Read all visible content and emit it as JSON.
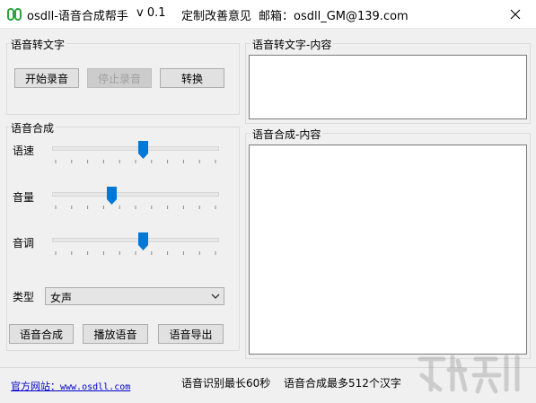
{
  "window": {
    "title": "osdll-语音合成帮手",
    "version": "v 0.1",
    "feedback_link": "定制改善意见",
    "email": "邮箱：osdll_GM@139.com"
  },
  "stt_group": {
    "title": "语音转文字",
    "start_button": "开始录音",
    "stop_button": "停止录音",
    "convert_button": "转换"
  },
  "stt_content": {
    "title": "语音转文字-内容",
    "value": ""
  },
  "tts_group": {
    "title": "语音合成",
    "speed_label": "语速",
    "volume_label": "音量",
    "pitch_label": "音调",
    "speed_value": 0.55,
    "volume_value": 0.35,
    "pitch_value": 0.55,
    "type_label": "类型",
    "type_value": "女声",
    "synthesize_button": "语音合成",
    "play_button": "播放语音",
    "export_button": "语音导出"
  },
  "tts_content": {
    "title": "语音合成-内容",
    "value": ""
  },
  "statusbar": {
    "site_label": "官方网站：",
    "site_url": "www.osdll.com",
    "stt_limit": "语音识别最长60秒",
    "tts_limit": "语音合成最多512个汉字"
  },
  "colors": {
    "slider_thumb": "#0078d7",
    "link": "#0000cc",
    "icon_green": "#2aa43a"
  }
}
